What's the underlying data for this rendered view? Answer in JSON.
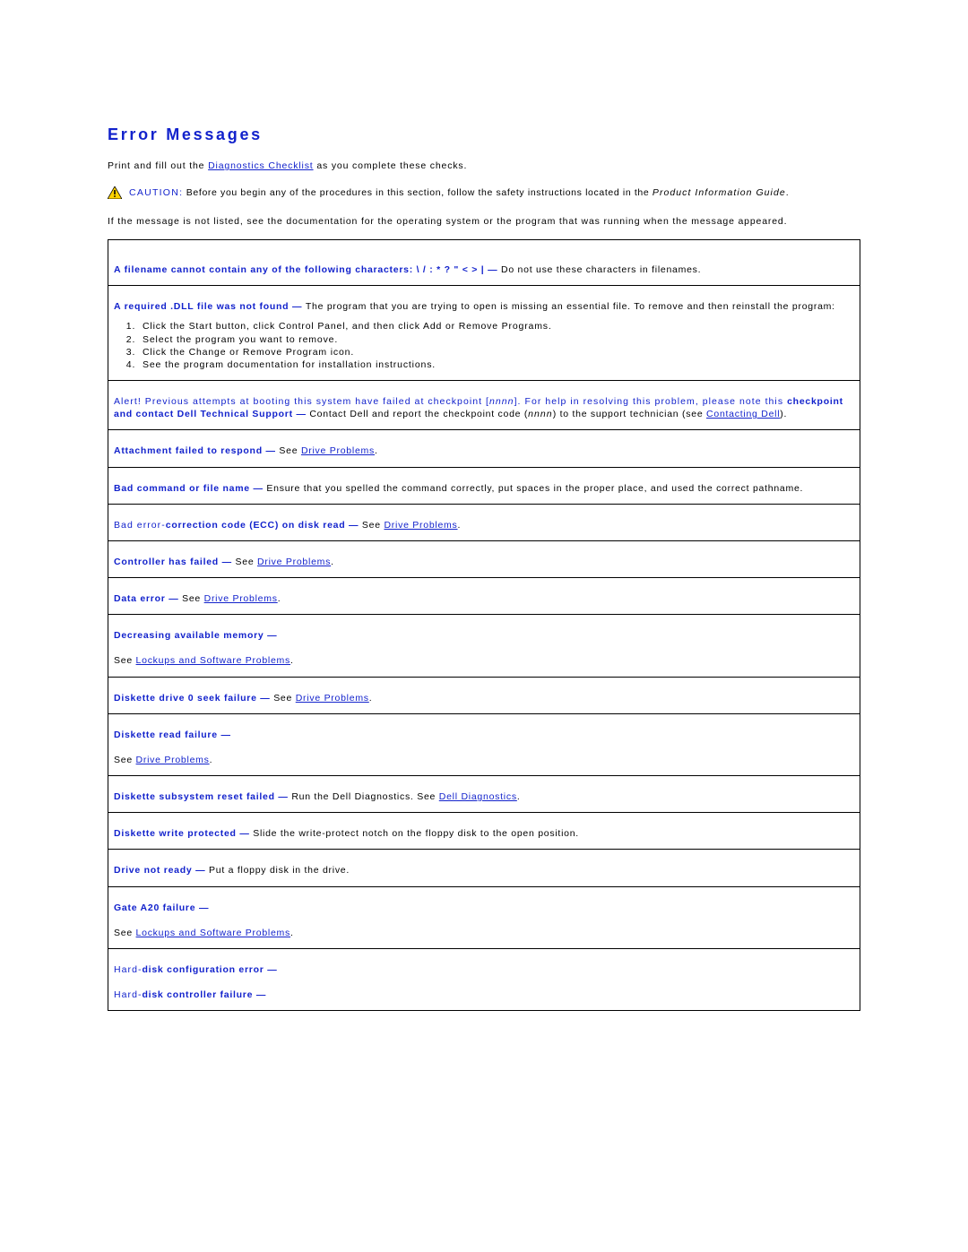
{
  "title": "Error Messages",
  "intro_pre": "Print and fill out the ",
  "intro_link": "Diagnostics Checklist",
  "intro_post": " as you complete these checks.",
  "caution_label": "CAUTION:",
  "caution_text1": " Before you begin any of the procedures in this section, follow the safety instructions located in the ",
  "caution_italic": "Product Information Guide",
  "caution_text2": ".",
  "not_listed": "If the message is not listed, see the documentation for the operating system or the program that was running when the message appeared.",
  "rows": {
    "filename": {
      "head": "A filename cannot contain any of the following characters: \\ / : * ? \" < > |  — ",
      "body": " Do not use these characters in filenames."
    },
    "dll": {
      "head": "A required .DLL file was not found — ",
      "body": " The program that you are trying to open is missing an essential file. To remove and then reinstall the program:",
      "steps": [
        "Click the Start button, click Control Panel, and then click Add or Remove Programs.",
        "Select the program you want to remove.",
        "Click the Change or Remove Program icon.",
        "See the program documentation for installation instructions."
      ]
    },
    "alert": {
      "pre_plain": "Alert! Previous attempts at booting this system have failed at checkpoint [",
      "pre_italic": "nnnn",
      "pre_plain2": "]. For help in resolving this problem, please note this ",
      "bold": "checkpoint and contact Dell Technical Support — ",
      "body1": " Contact Dell and report the checkpoint code (",
      "body_italic": "nnnn",
      "body2": ") to the support technician (see ",
      "link": "Contacting Dell",
      "body3": ")."
    },
    "attach": {
      "head": "Attachment failed to respond — ",
      "see": " See ",
      "link": "Drive Problems",
      "post": "."
    },
    "badcmd": {
      "head": "Bad command or file name — ",
      "body": " Ensure that you spelled the command correctly, put spaces in the proper place, and used the correct pathname."
    },
    "ecc": {
      "pre_plain": "Bad error-",
      "bold": "correction code (ECC) on disk read — ",
      "see": " See ",
      "link": "Drive Problems",
      "post": "."
    },
    "controller": {
      "head": "Controller has failed — ",
      "see": " See ",
      "link": "Drive Problems",
      "post": "."
    },
    "dataerr": {
      "head": "Data error — ",
      "see": " See ",
      "link": "Drive Problems",
      "post": "."
    },
    "decmem": {
      "head": "Decreasing available memory —",
      "see": "See ",
      "link": "Lockups and Software Problems",
      "post": "."
    },
    "seek": {
      "head": "Diskette drive 0 seek failure — ",
      "see": " See ",
      "link": "Drive Problems",
      "post": "."
    },
    "readfail": {
      "head": "Diskette read failure —",
      "see": "See ",
      "link": "Drive Problems",
      "post": "."
    },
    "subsys": {
      "head": "Diskette subsystem reset failed — ",
      "body": " Run the Dell Diagnostics. See ",
      "link": "Dell Diagnostics",
      "post": "."
    },
    "writeprot": {
      "head": "Diskette write protected — ",
      "body": " Slide the write-protect notch on the floppy disk to the open position."
    },
    "notready": {
      "head": "Drive not ready — ",
      "body": " Put a floppy disk in the drive."
    },
    "gate": {
      "head": "Gate A20 failure —",
      "see": "See ",
      "link": "Lockups and Software Problems",
      "post": "."
    },
    "hdcfg": {
      "pre_plain": "Hard-",
      "bold": "disk configuration error —"
    },
    "hdctl": {
      "pre_plain": "Hard-",
      "bold": "disk controller failure —"
    }
  }
}
